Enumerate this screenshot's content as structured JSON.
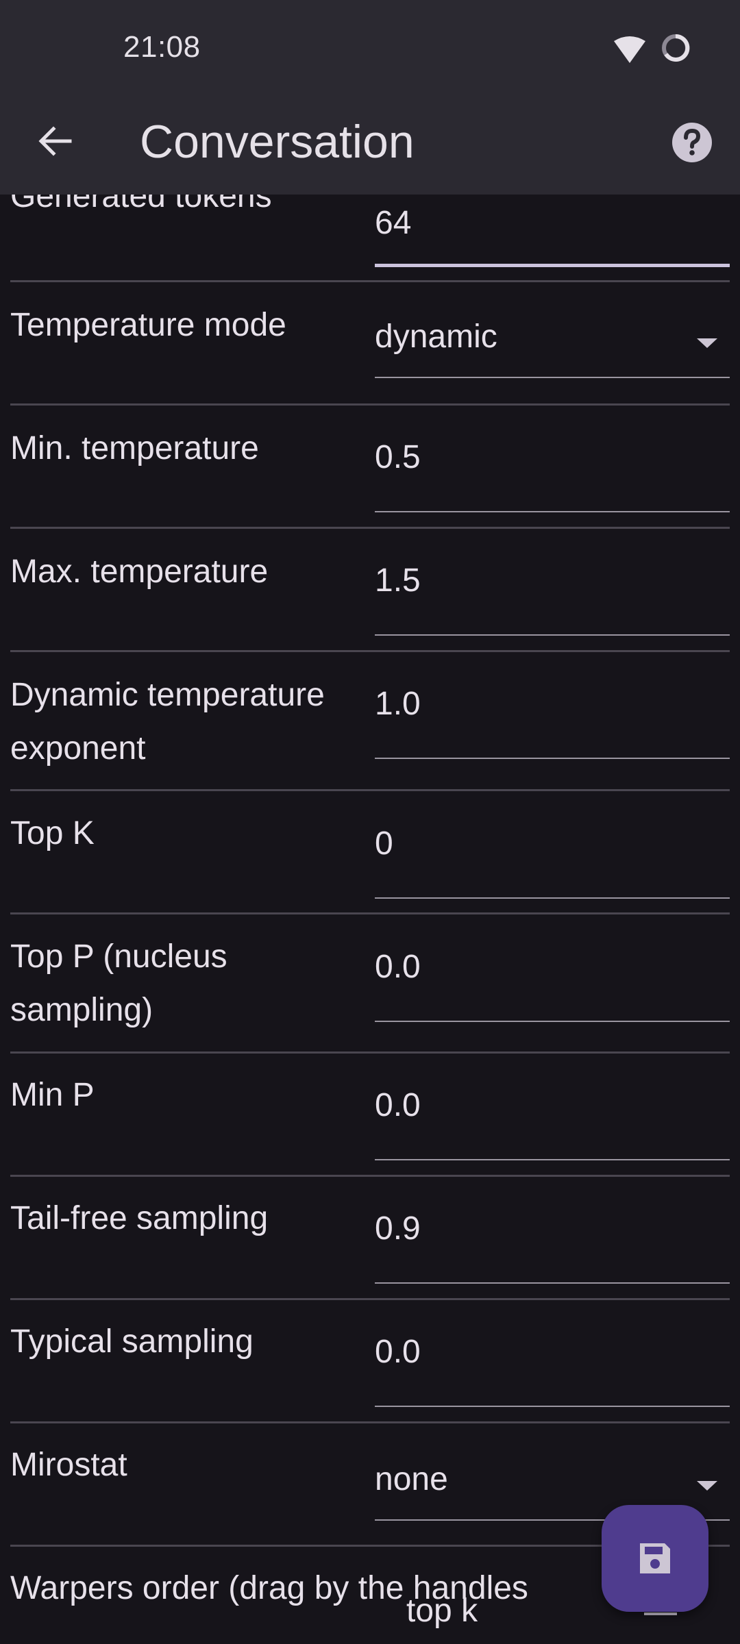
{
  "status_bar": {
    "time": "21:08",
    "icons": [
      "wifi-icon",
      "battery-ring-icon"
    ]
  },
  "app_bar": {
    "title": "Conversation",
    "back_icon": "arrow-back-icon",
    "help_icon": "help-icon"
  },
  "settings": [
    {
      "label": "Generated tokens",
      "value": "64",
      "type": "number",
      "focused": true
    },
    {
      "label": "Temperature mode",
      "value": "dynamic",
      "type": "dropdown"
    },
    {
      "label": "Min. temperature",
      "value": "0.5",
      "type": "number"
    },
    {
      "label": "Max. temperature",
      "value": "1.5",
      "type": "number"
    },
    {
      "label": "Dynamic temperature exponent",
      "value": "1.0",
      "type": "number"
    },
    {
      "label": "Top K",
      "value": "0",
      "type": "number"
    },
    {
      "label": "Top P (nucleus sampling)",
      "value": "0.0",
      "type": "number"
    },
    {
      "label": "Min P",
      "value": "0.0",
      "type": "number"
    },
    {
      "label": "Tail-free sampling",
      "value": "0.9",
      "type": "number"
    },
    {
      "label": "Typical sampling",
      "value": "0.0",
      "type": "number"
    },
    {
      "label": "Mirostat",
      "value": "none",
      "type": "dropdown"
    },
    {
      "label": "Warpers order (drag by the handles",
      "type": "reorder-list"
    }
  ],
  "warpers_order": {
    "items": [
      "top k"
    ]
  },
  "fab": {
    "icon": "save-icon"
  },
  "colors": {
    "background": "#16141a",
    "app_bar": "#2b2931",
    "fab": "#4f3c8e",
    "focus_underline": "#cbc3dd",
    "divider": "#4a4650"
  }
}
